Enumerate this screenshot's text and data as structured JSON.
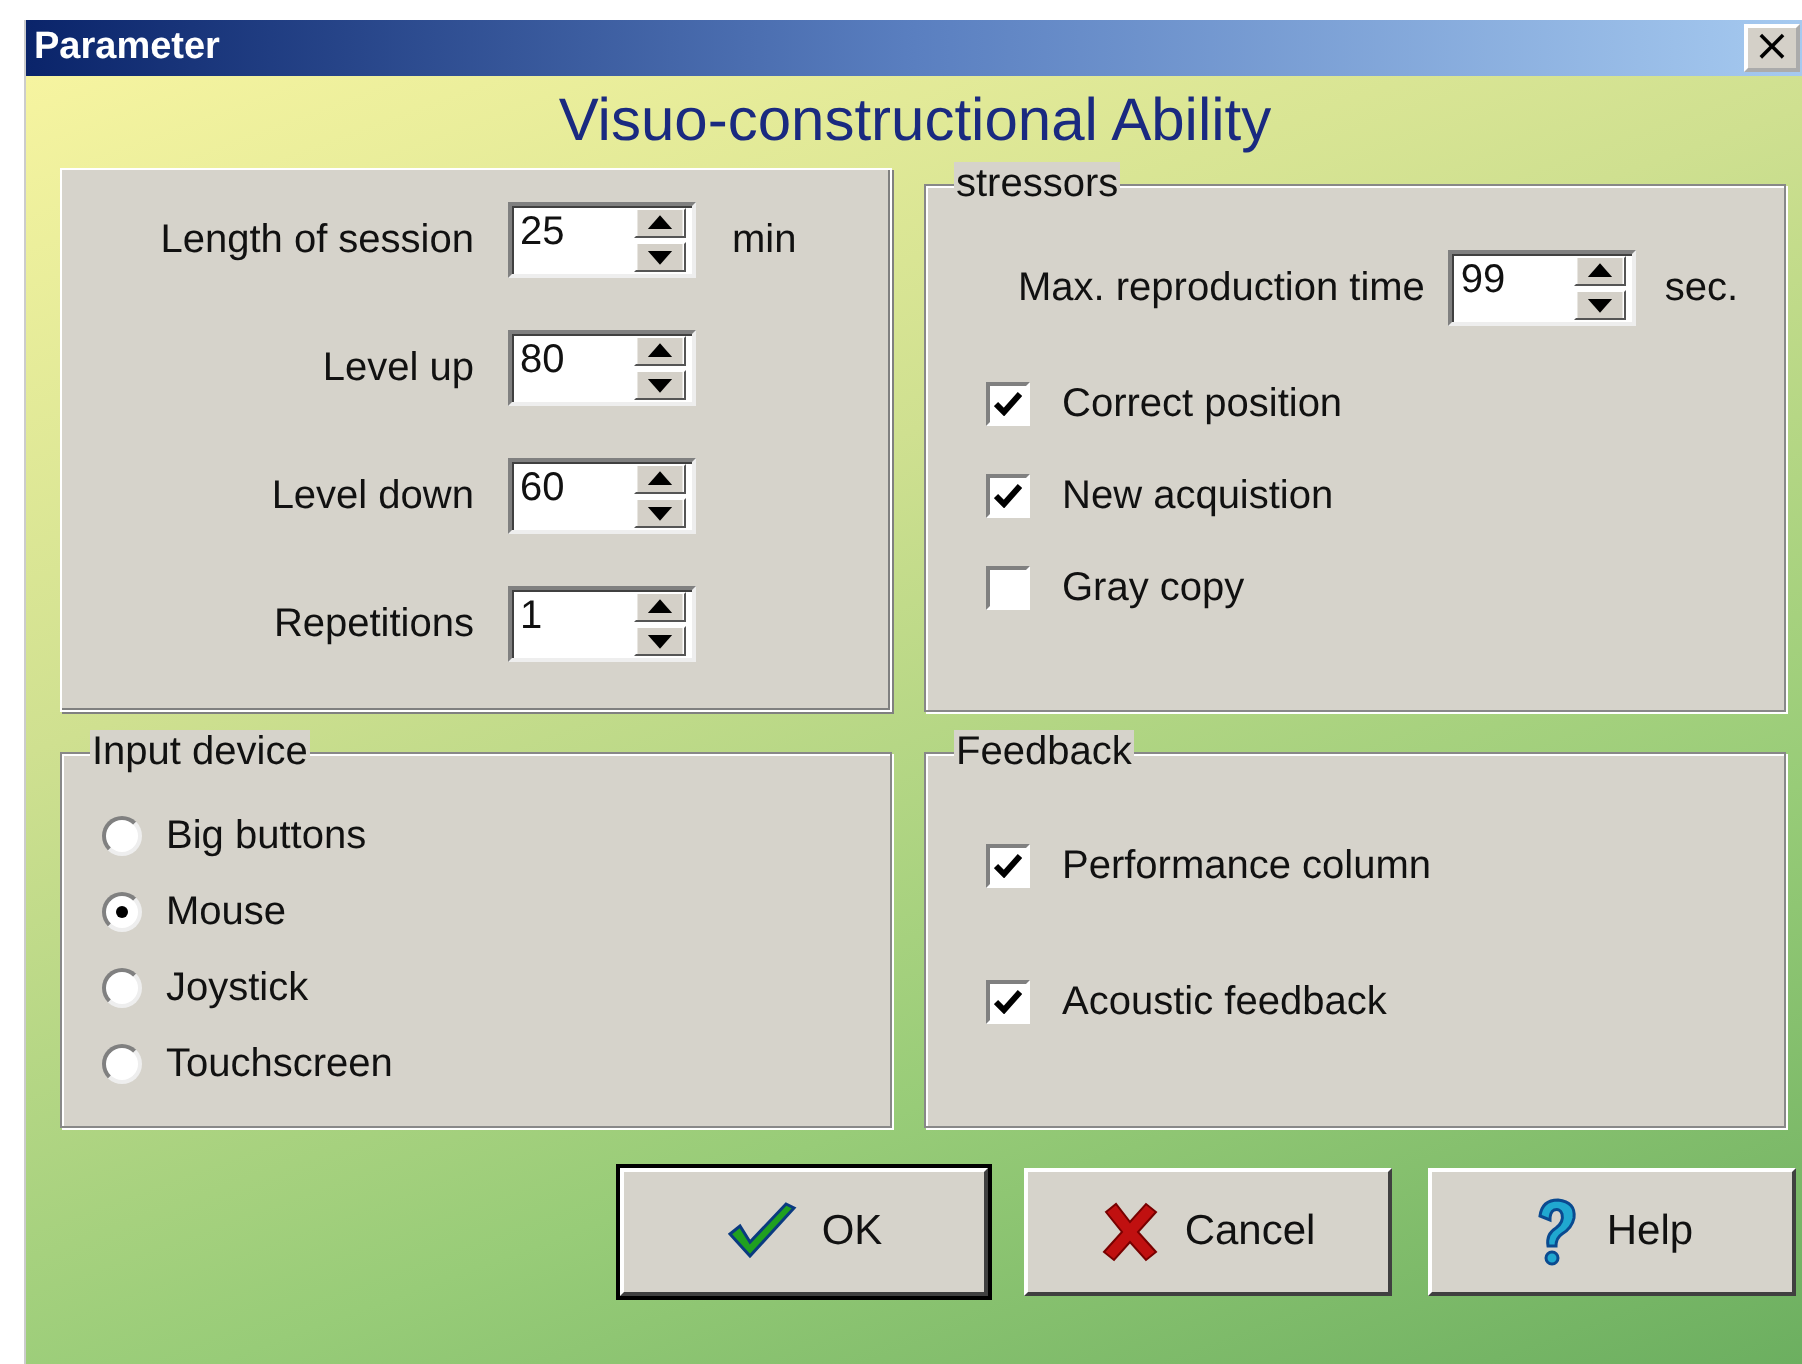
{
  "window": {
    "title": "Parameter",
    "close": "×"
  },
  "heading": "Visuo-constructional Ability",
  "session": {
    "rows": [
      {
        "label": "Length of session",
        "value": "25",
        "unit": "min"
      },
      {
        "label": "Level up",
        "value": "80"
      },
      {
        "label": "Level down",
        "value": "60"
      },
      {
        "label": "Repetitions",
        "value": "1"
      }
    ]
  },
  "stressors": {
    "title": "stressors",
    "time": {
      "label": "Max. reproduction time",
      "value": "99",
      "unit": "sec."
    },
    "options": [
      {
        "label": "Correct position",
        "checked": true
      },
      {
        "label": "New acquistion",
        "checked": true
      },
      {
        "label": "Gray copy",
        "checked": false
      }
    ]
  },
  "input_device": {
    "title": "Input device",
    "options": [
      {
        "label": "Big buttons",
        "selected": false
      },
      {
        "label": "Mouse",
        "selected": true
      },
      {
        "label": "Joystick",
        "selected": false
      },
      {
        "label": "Touchscreen",
        "selected": false
      }
    ]
  },
  "feedback": {
    "title": "Feedback",
    "options": [
      {
        "label": "Performance column",
        "checked": true
      },
      {
        "label": "Acoustic feedback",
        "checked": true
      }
    ]
  },
  "buttons": [
    {
      "label": "OK",
      "kind": "ok",
      "default": true
    },
    {
      "label": "Cancel",
      "kind": "cancel",
      "default": false
    },
    {
      "label": "Help",
      "kind": "help",
      "default": false
    }
  ]
}
